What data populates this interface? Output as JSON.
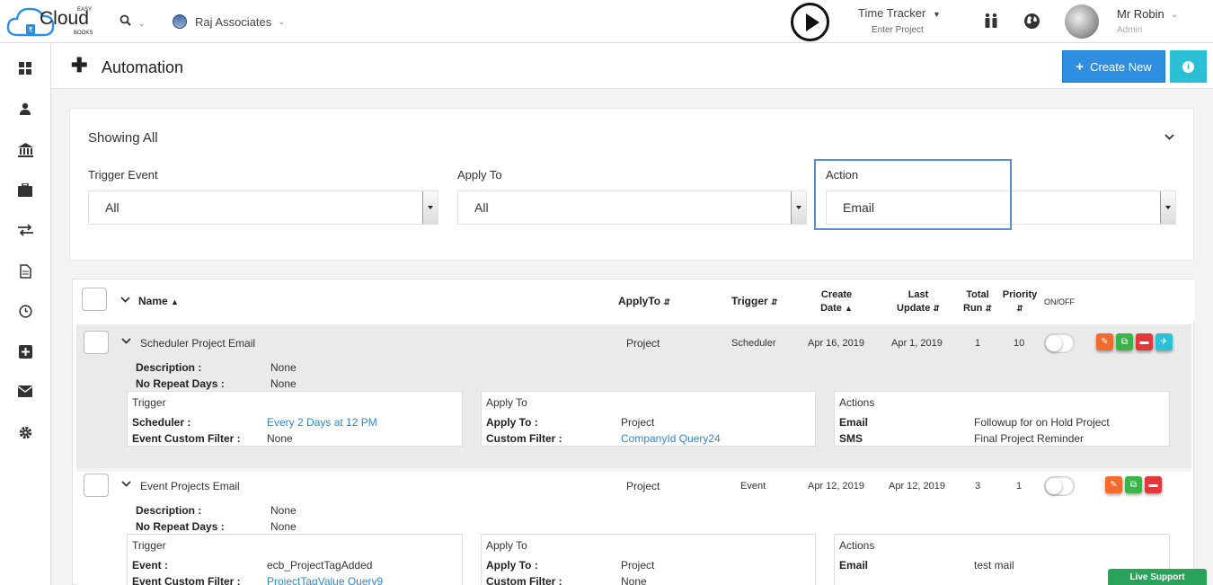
{
  "brand": {
    "top": "EASY",
    "name": "Cloud",
    "sub": "BOOKS",
    "accent": "#2e8fe0"
  },
  "header": {
    "company": "Raj Associates",
    "time_tracker": "Time Tracker",
    "time_tracker_sub": "Enter Project",
    "user_name": "Mr Robin",
    "user_role": "Admin"
  },
  "page": {
    "title": "Automation",
    "create_label": "Create New"
  },
  "filter": {
    "showing": "Showing All",
    "trigger_label": "Trigger Event",
    "trigger_value": "All",
    "apply_label": "Apply To",
    "apply_value": "All",
    "action_label": "Action",
    "action_value": "Email"
  },
  "columns": {
    "name": "Name",
    "applyto": "ApplyTo",
    "trigger": "Trigger",
    "create1": "Create",
    "create2": "Date",
    "update1": "Last",
    "update2": "Update",
    "total1": "Total",
    "total2": "Run",
    "priority": "Priority",
    "onoff": "ON/OFF"
  },
  "rows": [
    {
      "name": "Scheduler Project Email",
      "applyto": "Project",
      "trigger": "Scheduler",
      "create_date": "Apr 16, 2019",
      "last_update": "Apr 1, 2019",
      "total_run": "1",
      "priority": "10",
      "desc_label": "Description :",
      "desc_value": "None",
      "norepeat_label": "No Repeat Days :",
      "norepeat_value": "None",
      "trigger_box": {
        "title": "Trigger",
        "l1": "Scheduler :",
        "v1": "Every 2 Days at 12 PM",
        "l2": "Event Custom Filter :",
        "v2": "None"
      },
      "apply_box": {
        "title": "Apply To",
        "l1": "Apply To :",
        "v1": "Project",
        "l2": "Custom Filter :",
        "v2": "CompanyId Query24"
      },
      "actions_box": {
        "title": "Actions",
        "l1": "Email",
        "v1": "Followup for on Hold Project",
        "l2": "SMS",
        "v2": "Final Project Reminder"
      }
    },
    {
      "name": "Event Projects Email",
      "applyto": "Project",
      "trigger": "Event",
      "create_date": "Apr 12, 2019",
      "last_update": "Apr 12, 2019",
      "total_run": "3",
      "priority": "1",
      "desc_label": "Description :",
      "desc_value": "None",
      "norepeat_label": "No Repeat Days :",
      "norepeat_value": "None",
      "trigger_box": {
        "title": "Trigger",
        "l1": "Event :",
        "v1": "ecb_ProjectTagAdded",
        "l2": "Event Custom Filter :",
        "v2": "ProjectTagValue Query9"
      },
      "apply_box": {
        "title": "Apply To",
        "l1": "Apply To :",
        "v1": "Project",
        "l2": "Custom Filter :",
        "v2": "None"
      },
      "actions_box": {
        "title": "Actions",
        "l1": "Email",
        "v1": "test mail"
      }
    }
  ],
  "live_support": "Live Support",
  "icons": [
    "search-icon",
    "play-icon",
    "people-icon",
    "globe-icon",
    "dashboard-icon",
    "user-icon",
    "bank-icon",
    "briefcase-icon",
    "transfer-icon",
    "document-icon",
    "clock-icon",
    "plus-square-icon",
    "mail-icon",
    "gear-icon",
    "edit-icon",
    "copy-icon",
    "delete-icon",
    "send-icon"
  ]
}
